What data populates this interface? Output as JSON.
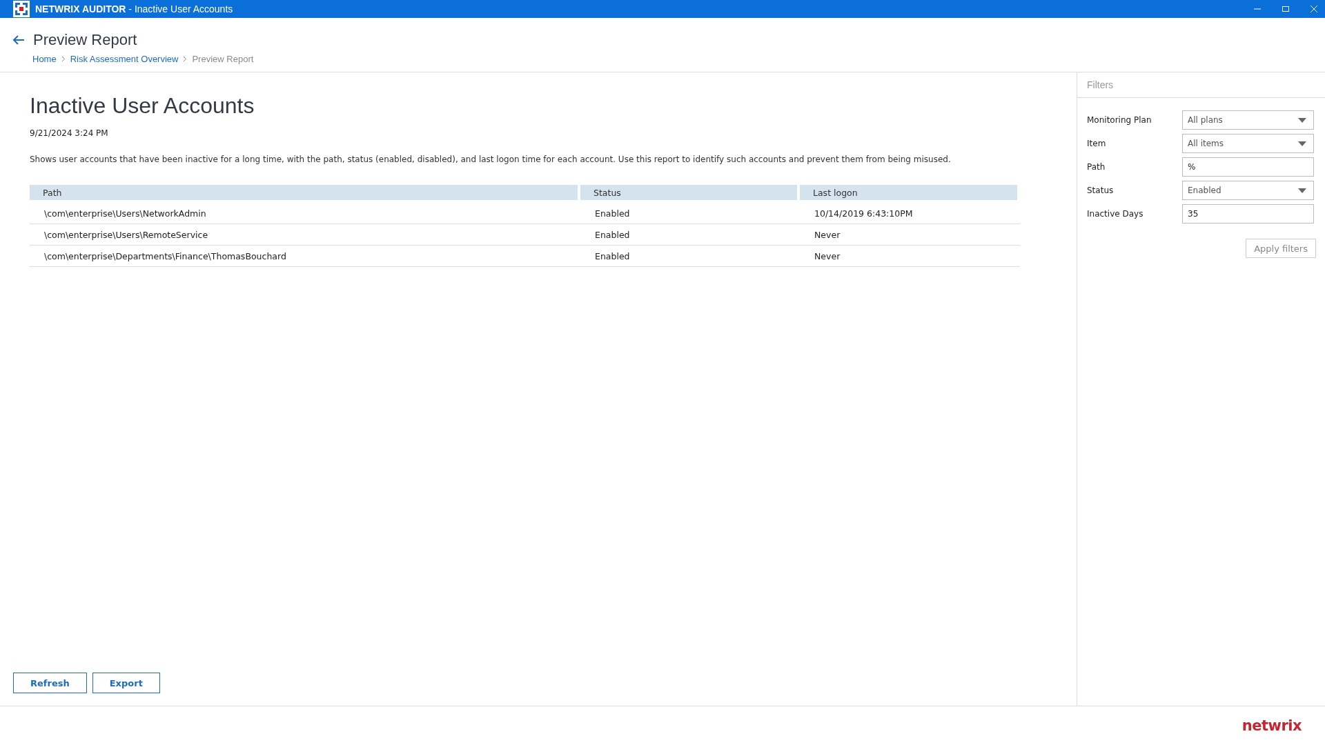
{
  "window": {
    "title": "**NETWRIX AUDITOR** - Inactive User Accounts"
  },
  "header": {
    "title": "Preview Report",
    "breadcrumb": [
      {
        "label": "Home",
        "current": false
      },
      {
        "label": "Risk Assessment Overview",
        "current": false
      },
      {
        "label": "Preview Report",
        "current": true
      }
    ]
  },
  "report": {
    "title": "Inactive User Accounts",
    "date": "9/21/2024 3:24 PM",
    "description": "Shows user accounts that have been inactive for a long time, with the path, status (enabled, disabled), and last logon time for each account. Use this report to identify such accounts and prevent them from being misused.",
    "table": {
      "columns": [
        "Path",
        "Status",
        "Last logon"
      ],
      "rows": [
        [
          "\\com\\enterprise\\Users\\NetworkAdmin",
          "Enabled",
          "10/14/2019 6:43:10PM"
        ],
        [
          "\\com\\enterprise\\Users\\RemoteService",
          "Enabled",
          "Never"
        ],
        [
          "\\com\\enterprise\\Departments\\Finance\\ThomasBouchard",
          "Enabled",
          "Never"
        ]
      ]
    }
  },
  "buttons": [
    "Refresh",
    "Export"
  ],
  "filters": {
    "title": "Filters",
    "fields": [
      {
        "label": "Monitoring Plan",
        "kind": "select",
        "value": "All plans"
      },
      {
        "label": "Item",
        "kind": "select",
        "value": "All items"
      },
      {
        "label": "Path",
        "kind": "text",
        "value": "%"
      },
      {
        "label": "Status",
        "kind": "select",
        "value": "Enabled"
      },
      {
        "label": "Inactive Days",
        "kind": "text",
        "value": "35"
      }
    ],
    "apply": "Apply filters"
  },
  "footer": {
    "brand": "netwrix"
  }
}
